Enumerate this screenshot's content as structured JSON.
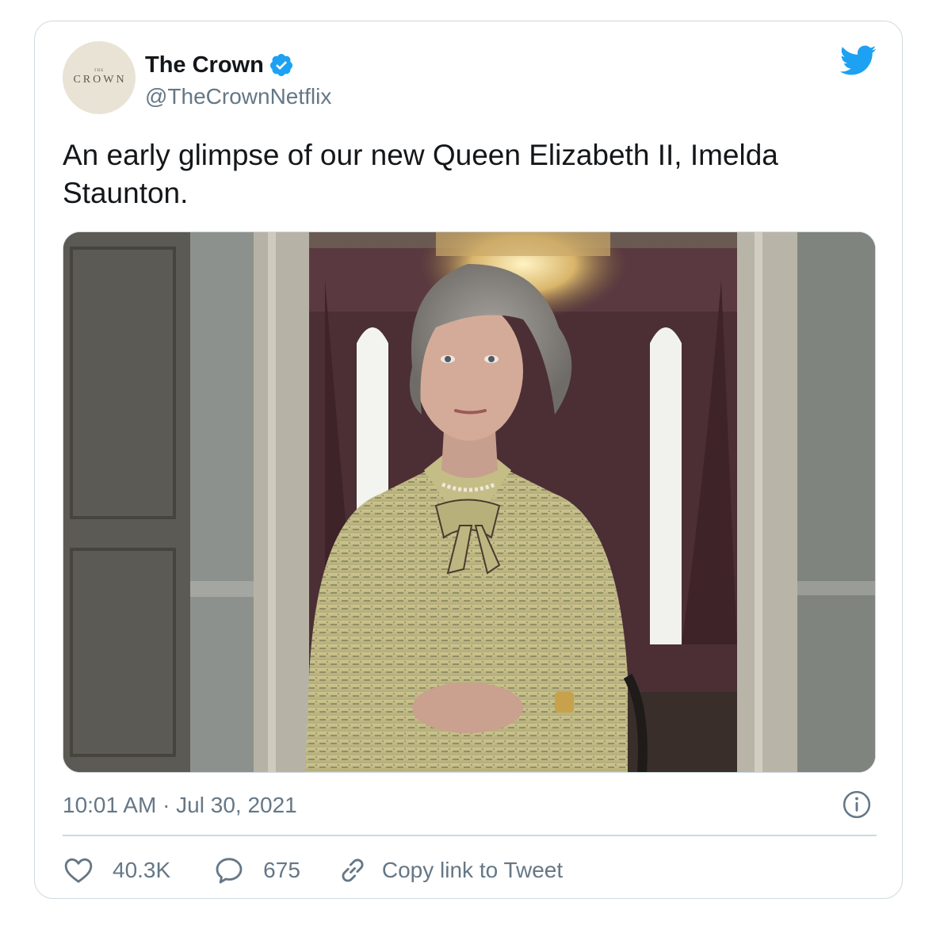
{
  "account": {
    "avatar_small_text": "THE",
    "avatar_text": "CROWN",
    "display_name": "The Crown",
    "handle": "@TheCrownNetflix",
    "verified": true
  },
  "tweet": {
    "text": "An early glimpse of our new Queen Elizabeth II, Imelda Staunton.",
    "timestamp": "10:01 AM · Jul 30, 2021"
  },
  "actions": {
    "likes": "40.3K",
    "replies": "675",
    "copy_link_label": "Copy link to Tweet"
  },
  "icons": {
    "brand": "twitter-bird-icon",
    "verified": "verified-badge-icon",
    "info": "info-icon",
    "like": "heart-icon",
    "reply": "speech-bubble-icon",
    "link": "link-icon"
  },
  "colors": {
    "brand_blue": "#1da1f2",
    "text_primary": "#14171a",
    "text_secondary": "#657786",
    "border": "#cfd9de"
  }
}
